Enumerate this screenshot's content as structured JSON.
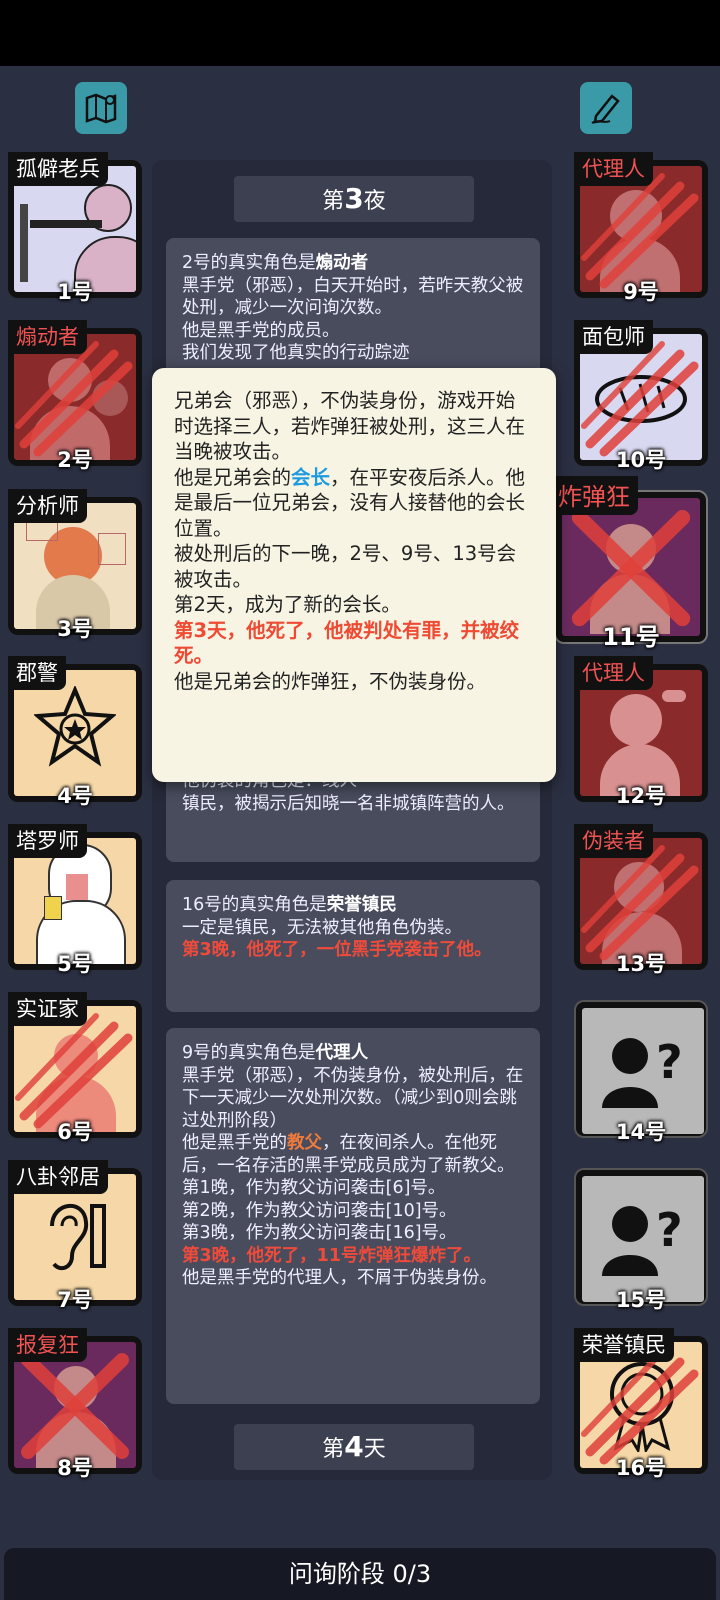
{
  "top": {
    "left_icon": "map-icon",
    "right_icon": "notepad-pen-icon"
  },
  "left_players": [
    {
      "role": "孤僻老兵",
      "number": "1号",
      "status": "alive",
      "name_color": "#ffffff"
    },
    {
      "role": "煽动者",
      "number": "2号",
      "status": "dead-attacked",
      "name_color": "#f15353"
    },
    {
      "role": "分析师",
      "number": "3号",
      "status": "alive",
      "name_color": "#ffffff"
    },
    {
      "role": "郡警",
      "number": "4号",
      "status": "alive",
      "name_color": "#ffffff"
    },
    {
      "role": "塔罗师",
      "number": "5号",
      "status": "alive",
      "name_color": "#ffffff"
    },
    {
      "role": "实证家",
      "number": "6号",
      "status": "dead-attacked",
      "name_color": "#ffffff"
    },
    {
      "role": "八卦邻居",
      "number": "7号",
      "status": "alive",
      "name_color": "#ffffff"
    },
    {
      "role": "报复狂",
      "number": "8号",
      "status": "dead-executed",
      "name_color": "#f15353"
    }
  ],
  "right_players": [
    {
      "role": "代理人",
      "number": "9号",
      "status": "dead-attacked",
      "name_color": "#f15353"
    },
    {
      "role": "面包师",
      "number": "10号",
      "status": "dead-attacked",
      "name_color": "#ffffff"
    },
    {
      "role": "炸弹狂",
      "number": "11号",
      "status": "dead-executed",
      "name_color": "#f15353"
    },
    {
      "role": "代理人",
      "number": "12号",
      "status": "alive",
      "name_color": "#f15353"
    },
    {
      "role": "伪装者",
      "number": "13号",
      "status": "dead-attacked",
      "name_color": "#f15353"
    },
    {
      "role": "",
      "number": "14号",
      "status": "unknown",
      "name_color": "#ffffff"
    },
    {
      "role": "",
      "number": "15号",
      "status": "unknown",
      "name_color": "#ffffff"
    },
    {
      "role": "荣誉镇民",
      "number": "16号",
      "status": "dead-attacked",
      "name_color": "#ffffff"
    }
  ],
  "log": {
    "night_label_prefix": "第",
    "night_label_num": "3",
    "night_label_suffix": "夜",
    "entry1": {
      "line1_prefix": "2号的真实角色是",
      "line1_role": "煽动者",
      "line2": "黑手党（邪恶），白天开始时，若昨天教父被处刑，减少一次问询次数。",
      "line3": "他是黑手党的成员。",
      "line4": "我们发现了他真实的行动踪迹"
    },
    "entry_hidden": {
      "line1": "他伪装的角色是：线人",
      "line2": "镇民，被揭示后知晓一名非城镇阵营的人。"
    },
    "entry2": {
      "line1_prefix": "16号的真实角色是",
      "line1_role": "荣誉镇民",
      "line2": "一定是镇民，无法被其他角色伪装。",
      "line3": "第3晚，他死了，一位黑手党袭击了他。"
    },
    "entry3": {
      "line1_prefix": "9号的真实角色是",
      "line1_role": "代理人",
      "line2": "黑手党（邪恶），不伪装身份，被处刑后，在下一天减少一次处刑次数。（减少到0则会跳过处刑阶段）",
      "line3_a": "他是黑手党的",
      "line3_b": "教父",
      "line3_c": "，在夜间杀人。在他死后，一名存活的黑手党成员成为了新教父。",
      "line4": "第1晚，作为教父访问袭击[6]号。",
      "line5": "第2晚，作为教父访问袭击[10]号。",
      "line6": "第3晚，作为教父访问袭击[16]号。",
      "line7": "第3晚，他死了，11号炸弹狂爆炸了。",
      "line8": "他是黑手党的代理人，不屑于伪装身份。"
    },
    "day_label_prefix": "第",
    "day_label_num": "4",
    "day_label_suffix": "天"
  },
  "tooltip": {
    "line1": "兄弟会（邪恶），不伪装身份，游戏开始时选择三人，若炸弹狂被处刑，这三人在当晚被攻击。",
    "line2_a": "他是兄弟会的",
    "line2_b": "会长",
    "line2_c": "，在平安夜后杀人。他是最后一位兄弟会，没有人接替他的会长位置。",
    "line3": "被处刑后的下一晚，2号、9号、13号会被攻击。",
    "line4": "第2天，成为了新的会长。",
    "line5": "第3天，他死了，他被判处有罪，并被绞死。",
    "line6": "他是兄弟会的炸弹狂，不伪装身份。"
  },
  "bottom": {
    "phase_label": "问询阶段 0/3"
  },
  "colors": {
    "background": "#2b2f42",
    "teal_button": "#3a9aa8",
    "red_text": "#ef4b3b",
    "blue_text": "#1e9be0",
    "tooltip_bg": "#f8f4e4"
  }
}
